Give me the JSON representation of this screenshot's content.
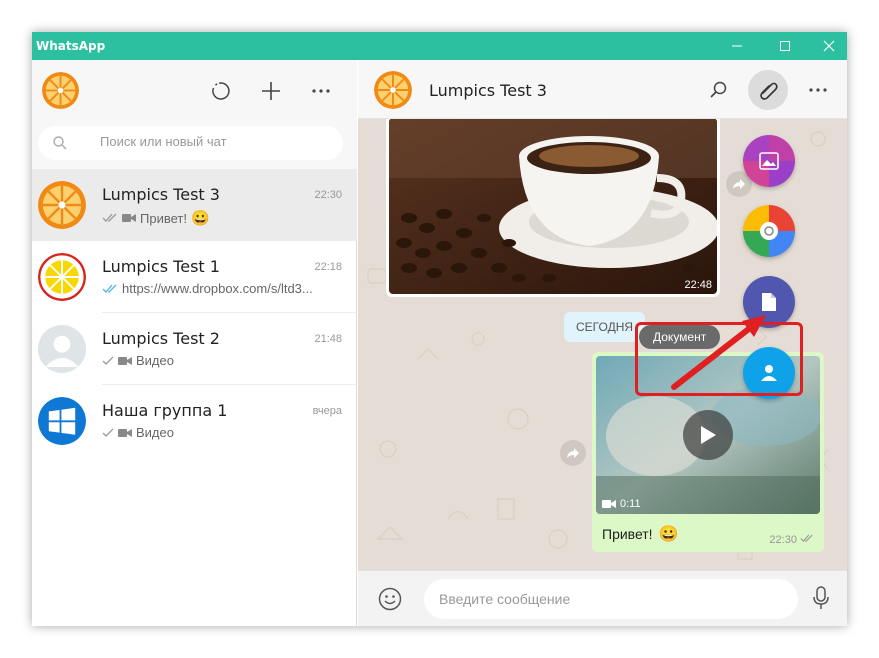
{
  "window": {
    "title": "WhatsApp"
  },
  "sidebar": {
    "search_placeholder": "Поиск или новый чат",
    "chats": [
      {
        "name": "Lumpics Test 3",
        "time": "22:30",
        "preview": "Привет!",
        "preview_type": "video-read-grey",
        "emoji": "😀"
      },
      {
        "name": "Lumpics Test 1",
        "time": "22:18",
        "preview": "https://www.dropbox.com/s/ltd3...",
        "preview_type": "read-blue"
      },
      {
        "name": "Lumpics Test 2",
        "time": "21:48",
        "preview": "Видео",
        "preview_type": "video-sent"
      },
      {
        "name": "Наша группа 1",
        "time": "вчера",
        "preview": "Видео",
        "preview_type": "video-sent"
      }
    ]
  },
  "conversation": {
    "contact_name": "Lumpics Test 3",
    "image_message": {
      "time": "22:48"
    },
    "date_divider": "СЕГОДНЯ",
    "video_message": {
      "duration": "0:11",
      "caption": "Привет!",
      "emoji": "😀",
      "time": "22:30"
    },
    "attach_menu": {
      "tooltip": "Документ",
      "items": [
        "gallery",
        "camera",
        "document",
        "contact"
      ]
    },
    "composer_placeholder": "Введите сообщение"
  },
  "colors": {
    "titlebar": "#2cc0a0",
    "accent_red": "#e02020",
    "document_fab": "#5157ae",
    "contact_fab": "#0fa2e8"
  }
}
